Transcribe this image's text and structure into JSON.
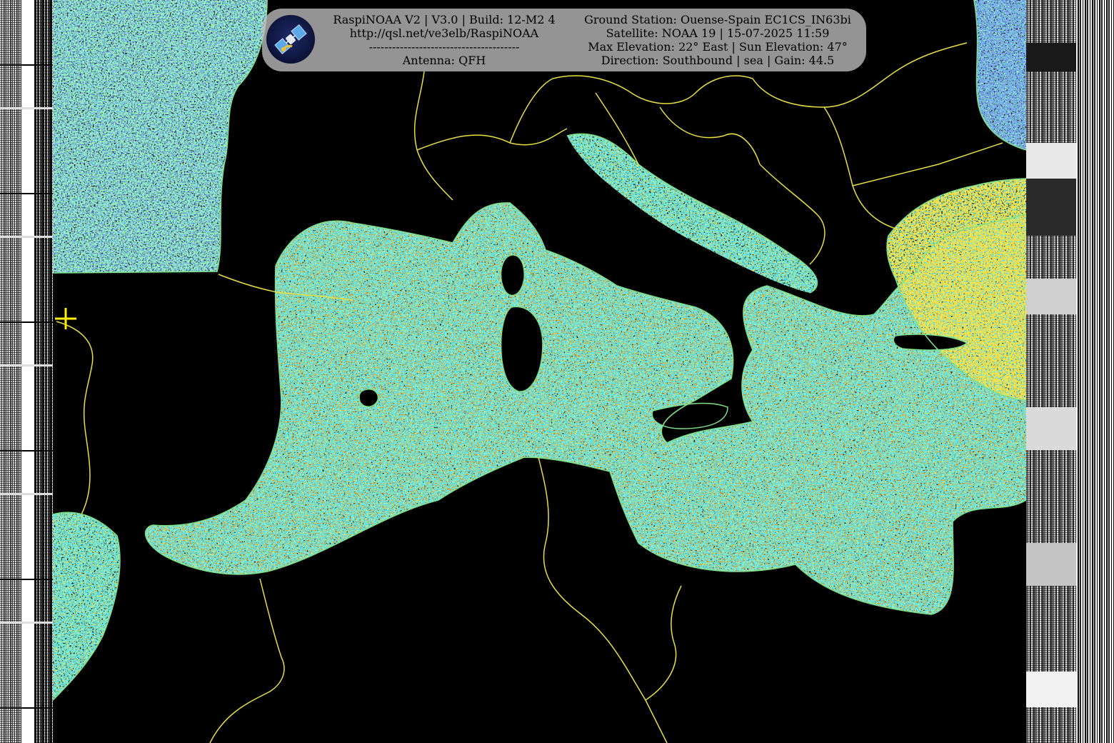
{
  "header": {
    "left_lines": [
      "RaspiNOAA V2 | V3.0 | Build: 12-M2 4",
      "http://qsl.net/ve3elb/RaspiNOAA",
      "---------------------------------------",
      "Antenna: QFH"
    ],
    "right_lines": [
      "Ground Station: Ouense-Spain EC1CS_IN63bi",
      "Satellite: NOAA 19 | 15-07-2025 11:59",
      "Max Elevation: 22° East | Sun Elevation: 47°",
      "Direction: Southbound | sea | Gain: 44.5"
    ],
    "logo_icon": "satellite-logo-icon"
  },
  "map": {
    "background_color": "#000000",
    "border_color": "#e8e040",
    "coastline_color": "#7ee08a",
    "crosshair_color": "#ffee00",
    "noise_palette": [
      "#ff2a00",
      "#ff8c00",
      "#ffd000",
      "#c8ff30",
      "#30e070",
      "#18c8d8",
      "#2a70ff",
      "#5a20c8"
    ]
  }
}
